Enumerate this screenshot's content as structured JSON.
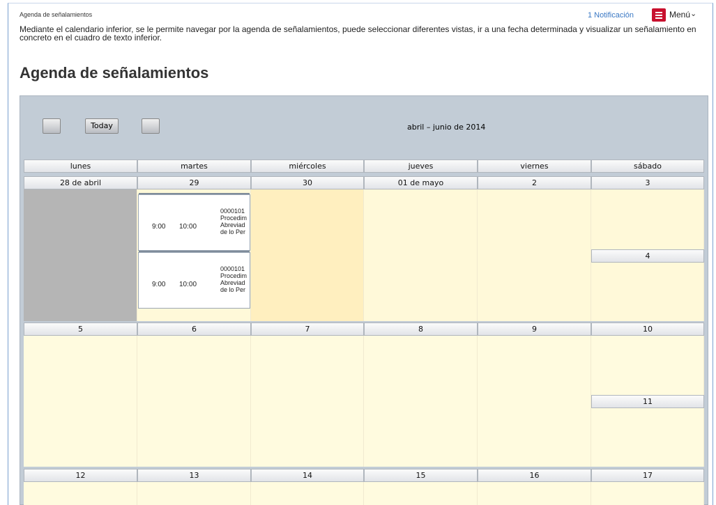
{
  "header": {
    "breadcrumb": "Agenda de señalamientos",
    "notification": "1 Notificación",
    "menu_label": "Menú",
    "menu_caret": "⌄"
  },
  "intro": "Mediante el calendario inferior, se le permite navegar por la agenda de señalamientos, puede seleccionar diferentes vistas, ir a una fecha determinada y visualizar un señalamiento en concreto en el cuadro de texto inferior.",
  "page_title": "Agenda de señalamientos",
  "calendar": {
    "today_label": "Today",
    "range_label": "abril – junio de 2014",
    "weekdays": [
      "lunes",
      "martes",
      "miércoles",
      "jueves",
      "viernes",
      "sábado"
    ],
    "weeks": [
      {
        "dates": [
          "28 de abril",
          "29",
          "30",
          "01 de mayo",
          "2",
          "3"
        ],
        "sunday": "4"
      },
      {
        "dates": [
          "5",
          "6",
          "7",
          "8",
          "9",
          "10"
        ],
        "sunday": "11"
      },
      {
        "dates": [
          "12",
          "13",
          "14",
          "15",
          "16",
          "17"
        ]
      }
    ],
    "events": [
      {
        "start": "9:00",
        "end": "10:00",
        "line1": "0000101",
        "line2": "Procedim",
        "line3": "Abreviad",
        "line4": "de lo Per"
      },
      {
        "start": "9:00",
        "end": "10:00",
        "line1": "0000101",
        "line2": "Procedim",
        "line3": "Abreviad",
        "line4": "de lo Per"
      }
    ]
  },
  "colors": {
    "accent": "#c8102e",
    "link": "#3a78c4",
    "day_cell": "#fff9d9",
    "past_cell": "#b5b5b5",
    "today_cell": "#ffefbf"
  }
}
